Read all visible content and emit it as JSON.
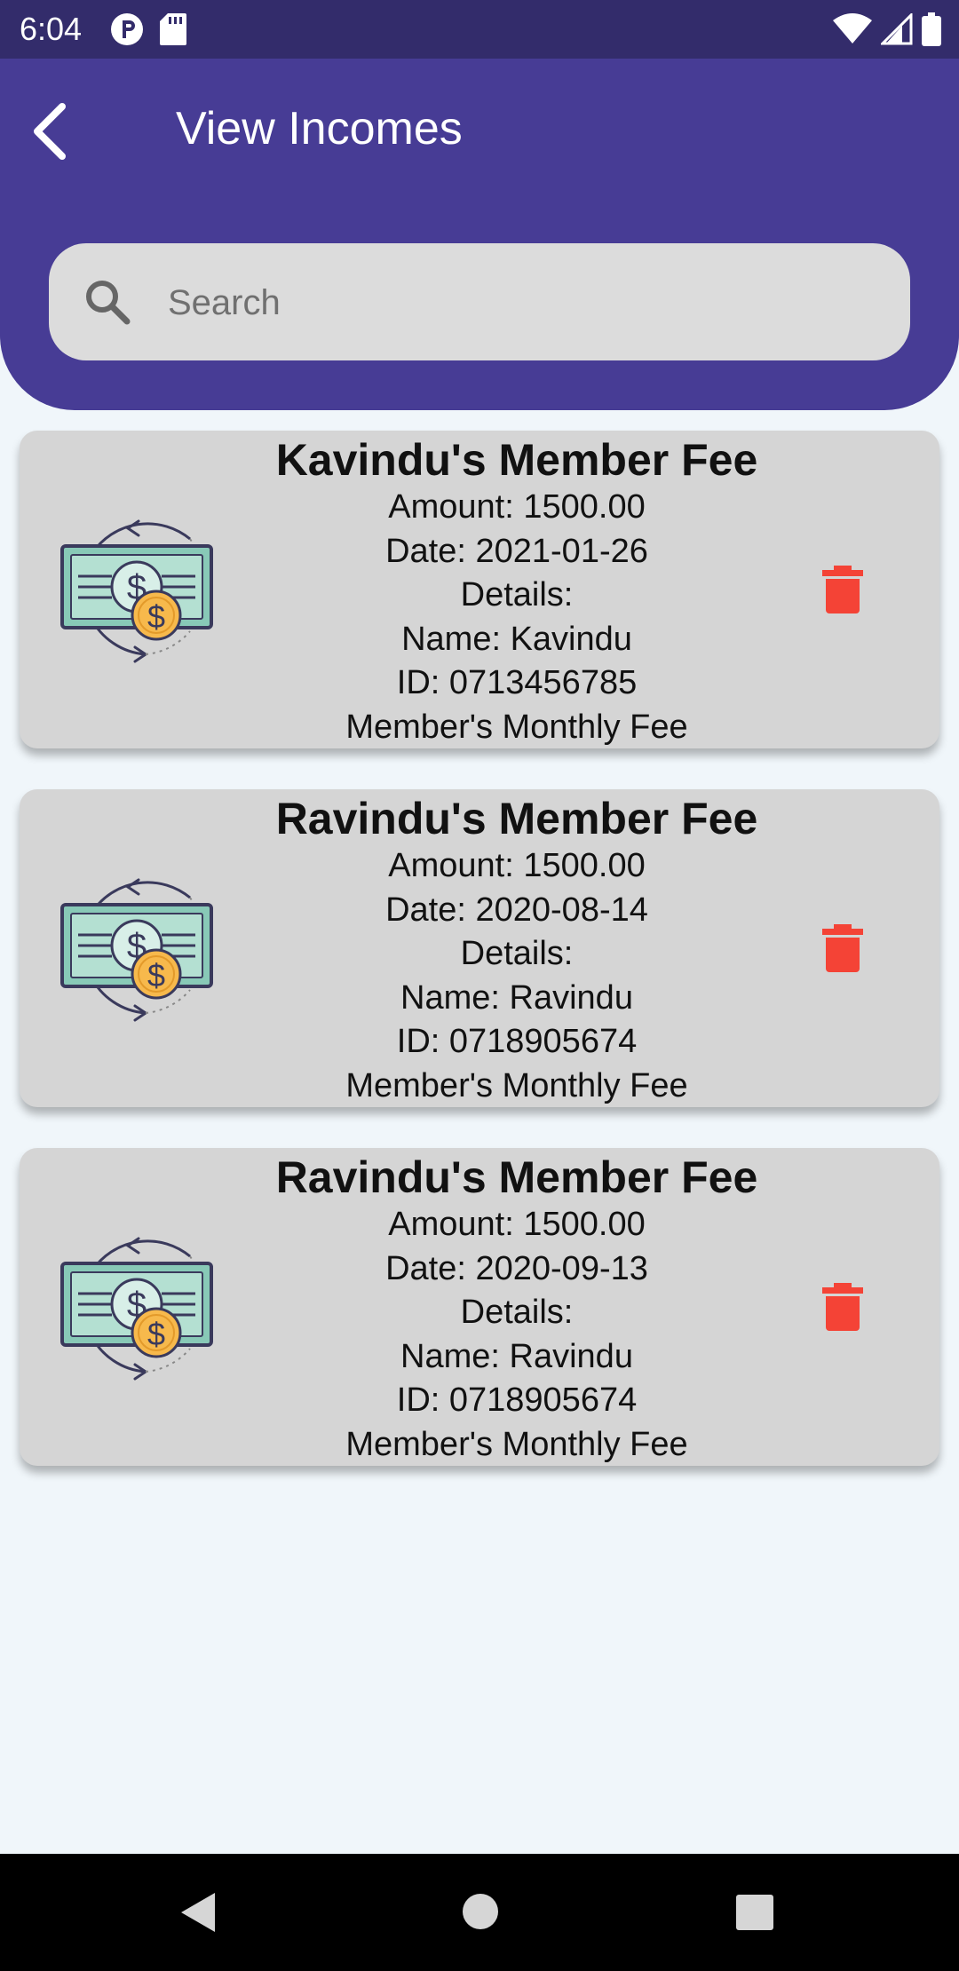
{
  "status_bar": {
    "time": "6:04",
    "icons": [
      "notification-p-icon",
      "sd-card-icon",
      "wifi-icon",
      "signal-icon",
      "battery-icon"
    ]
  },
  "header": {
    "title": "View Incomes",
    "background_color": "#473c95"
  },
  "search": {
    "placeholder": "Search",
    "value": ""
  },
  "incomes": [
    {
      "title": "Kavindu's Member Fee",
      "amount": "Amount: 1500.00",
      "date": "Date: 2021-01-26",
      "details_label": "Details:",
      "name": "Name: Kavindu",
      "id": "ID: 0713456785",
      "description": "Member's Monthly Fee"
    },
    {
      "title": "Ravindu's Member Fee",
      "amount": "Amount: 1500.00",
      "date": "Date: 2020-08-14",
      "details_label": "Details:",
      "name": "Name: Ravindu",
      "id": "ID: 0718905674",
      "description": "Member's Monthly Fee"
    },
    {
      "title": "Ravindu's Member Fee",
      "amount": "Amount: 1500.00",
      "date": "Date: 2020-09-13",
      "details_label": "Details:",
      "name": "Name: Ravindu",
      "id": "ID: 0718905674",
      "description": "Member's Monthly Fee"
    }
  ],
  "colors": {
    "accent": "#473c95",
    "status_bar": "#332c6b",
    "card": "#d5d5d5",
    "delete": "#f44336",
    "page_background": "#f0f6fa"
  },
  "nav_bar": {
    "icons": [
      "nav-back-icon",
      "nav-home-icon",
      "nav-recents-icon"
    ]
  }
}
